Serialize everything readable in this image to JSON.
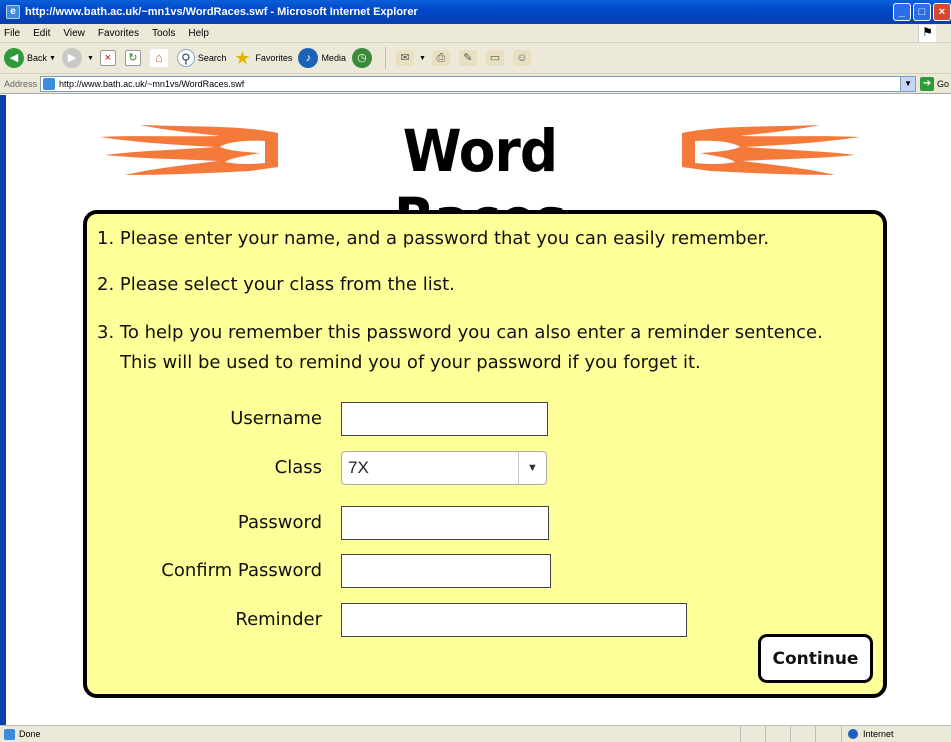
{
  "window": {
    "title": "http://www.bath.ac.uk/~mn1vs/WordRaces.swf - Microsoft Internet Explorer"
  },
  "menu": [
    "File",
    "Edit",
    "View",
    "Favorites",
    "Tools",
    "Help"
  ],
  "toolbar": {
    "back_label": "Back",
    "search_label": "Search",
    "favorites_label": "Favorites",
    "media_label": "Media"
  },
  "address": {
    "label": "Address",
    "url": "http://www.bath.ac.uk/~mn1vs/WordRaces.swf",
    "go_label": "Go"
  },
  "page": {
    "title": "Word Races",
    "instructions": [
      "1. Please enter your name, and a password that you can easily remember.",
      "2. Please select your class from the list.",
      "3. To help you remember this password you can also enter a reminder sentence.",
      "This will be used to remind you of your password if you forget it."
    ],
    "form": {
      "username_label": "Username",
      "username_value": "",
      "class_label": "Class",
      "class_value": "7X",
      "password_label": "Password",
      "password_value": "",
      "confirm_label": "Confirm Password",
      "confirm_value": "",
      "reminder_label": "Reminder",
      "reminder_value": ""
    },
    "continue_label": "Continue"
  },
  "status": {
    "text": "Done",
    "zone": "Internet"
  },
  "colors": {
    "panel_bg": "#ffff99",
    "flame": "#f47a3c",
    "titlebar": "#0a5fd8"
  }
}
